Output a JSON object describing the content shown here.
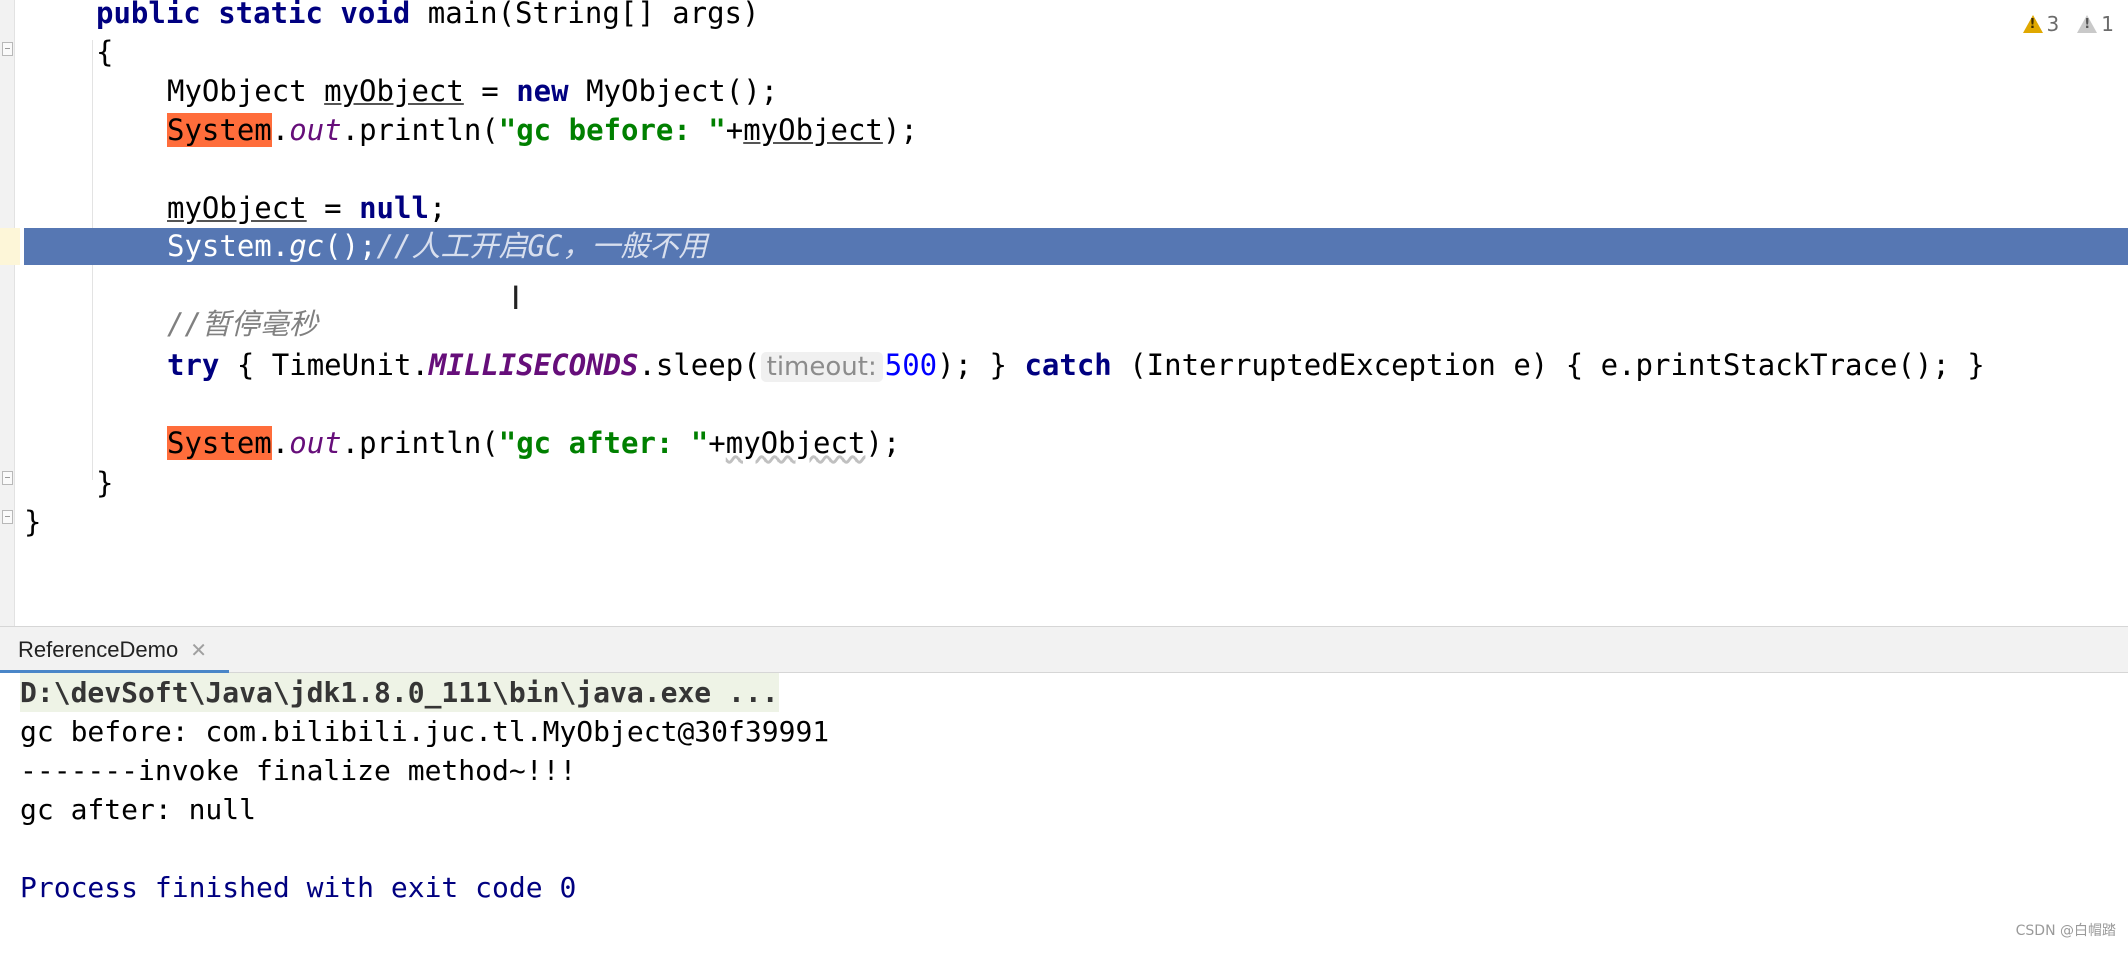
{
  "editor": {
    "lines": {
      "l1": {
        "kw1": "public static void ",
        "rest": "main(String[] args)"
      },
      "l2": "{",
      "l3": {
        "type": "MyObject ",
        "var": "myObject",
        "eq": " = ",
        "new": "new",
        "rest": " MyObject();"
      },
      "l4": {
        "sys": "System",
        "dot": ".",
        "out": "out",
        "mid": ".println(",
        "str": "\"gc before: \"",
        "plus": "+",
        "var": "myObject",
        "end": ");"
      },
      "l6": {
        "var": "myObject",
        "eq": " = ",
        "null": "null",
        "end": ";"
      },
      "l7": {
        "code": "System.",
        "gc": "gc",
        "paren": "();",
        "comment": "//人工开启GC，一般不用"
      },
      "l9": "//暂停毫秒",
      "l10": {
        "try": "try",
        "a": " { TimeUnit.",
        "ms": "MILLISECONDS",
        "b": ".sleep(",
        "hint": "timeout:",
        "num": "500",
        "c": "); } ",
        "catch": "catch",
        "d": " (InterruptedException e) { e.printStackTrace(); }"
      },
      "l12": {
        "sys": "System",
        "dot": ".",
        "out": "out",
        "mid": ".println(",
        "str": "\"gc after: \"",
        "plus": "+",
        "var": "myObject",
        "end": ");"
      },
      "l13": "}",
      "l14": "}"
    },
    "inspections": {
      "warnings": "3",
      "weak_warnings": "1"
    }
  },
  "run": {
    "tab_label": "ReferenceDemo",
    "console": [
      "D:\\devSoft\\Java\\jdk1.8.0_111\\bin\\java.exe ...",
      "gc before: com.bilibili.juc.tl.MyObject@30f39991",
      "-------invoke finalize method~!!!",
      "gc after: null",
      "Process finished with exit code 0"
    ]
  },
  "watermark": "CSDN @白帽踏"
}
